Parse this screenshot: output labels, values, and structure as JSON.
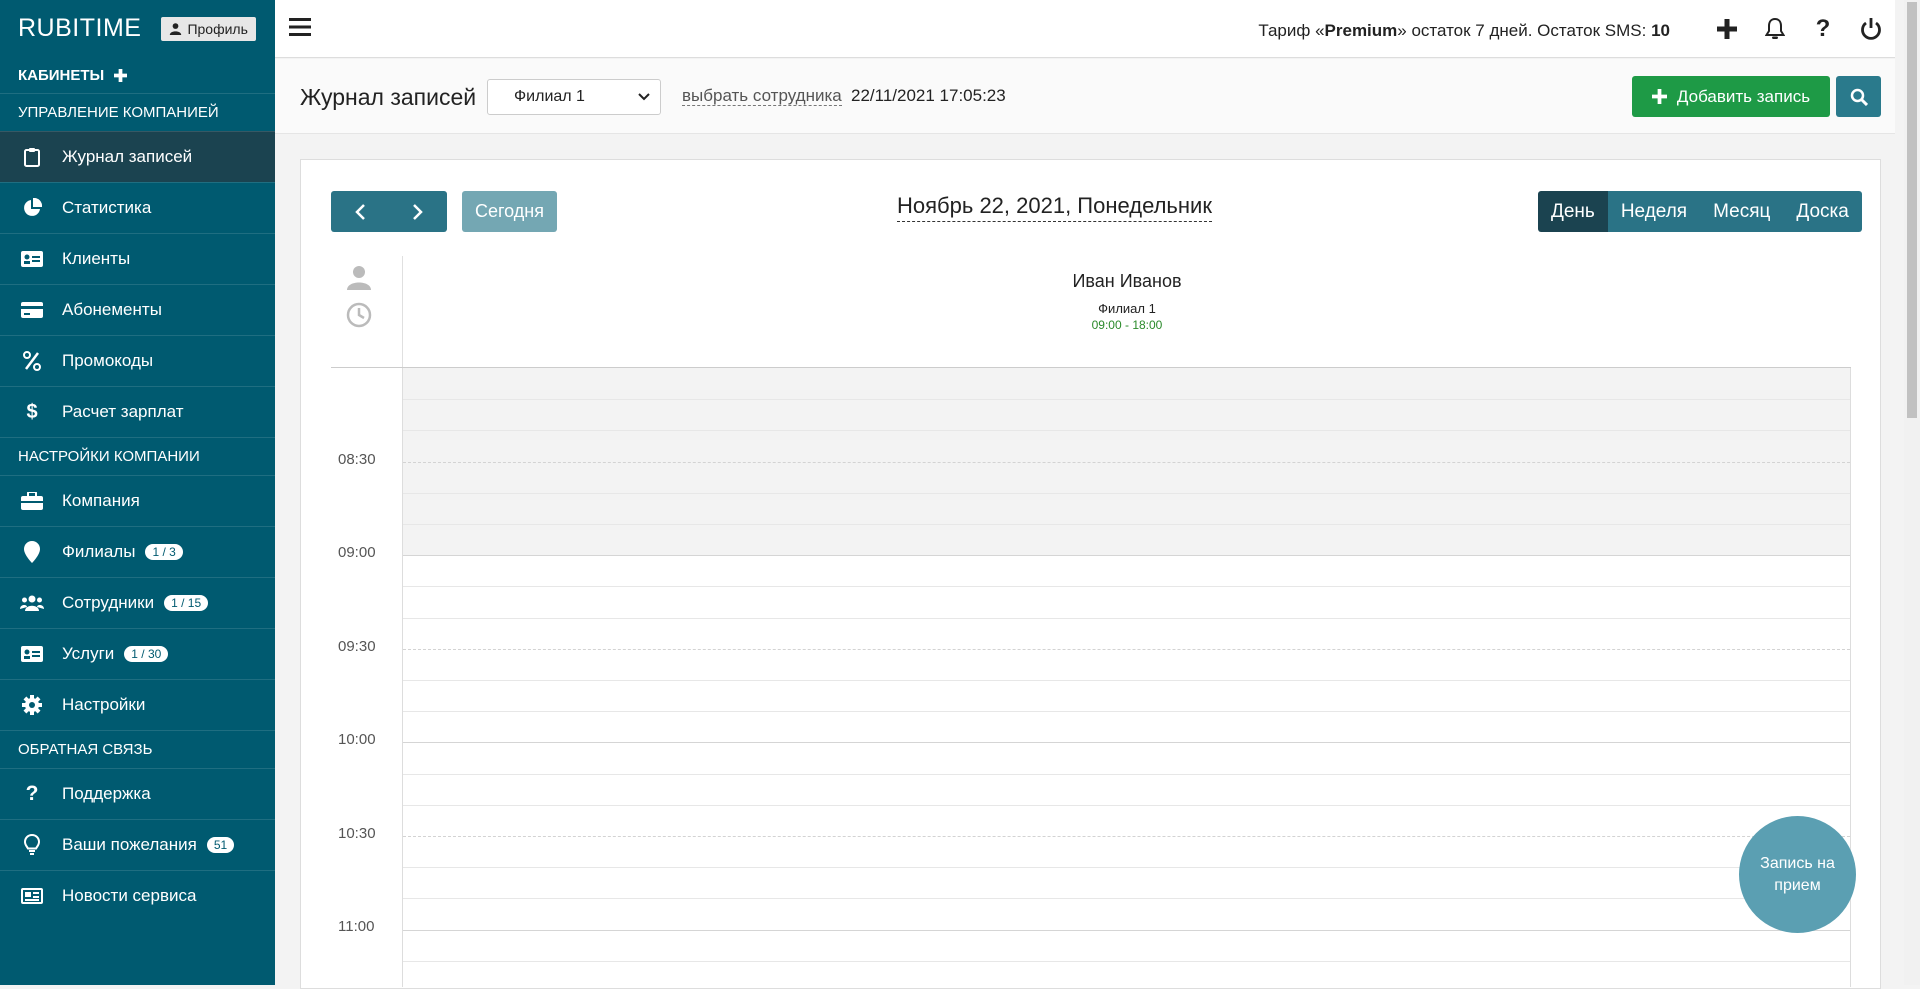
{
  "sidebar": {
    "brand": "RUBITIME",
    "profile_label": "Профиль",
    "cabinets_label": "КАБИНЕТЫ",
    "sections": {
      "management": "УПРАВЛЕНИЕ КОМПАНИЕЙ",
      "settings": "НАСТРОЙКИ КОМПАНИИ",
      "feedback": "ОБРАТНАЯ СВЯЗЬ"
    },
    "items": {
      "journal": "Журнал записей",
      "stats": "Статистика",
      "clients": "Клиенты",
      "subscriptions": "Абонементы",
      "promocodes": "Промокоды",
      "salary": "Расчет зарплат",
      "company": "Компания",
      "branches": "Филиалы",
      "branches_badge": "1 / 3",
      "employees": "Сотрудники",
      "employees_badge": "1 / 15",
      "services": "Услуги",
      "services_badge": "1 / 30",
      "settings": "Настройки",
      "support": "Поддержка",
      "wishes": "Ваши пожелания",
      "wishes_badge": "51",
      "news": "Новости сервиса"
    },
    "colors": {
      "bg": "#005a70",
      "active": "#1b4350"
    }
  },
  "topbar": {
    "tariff_prefix": "Тариф «",
    "tariff_name": "Premium",
    "tariff_suffix": "» остаток 7 дней. Остаток SMS: ",
    "sms_count": "10"
  },
  "header": {
    "title": "Журнал записей",
    "branch_selected": "Филиал 1",
    "pick_employee": "выбрать сотрудника",
    "datetime": "22/11/2021 17:05:23",
    "add_button": "Добавить запись"
  },
  "calendar": {
    "today_button": "Сегодня",
    "date_title": "Ноябрь 22, 2021, Понедельник",
    "views": [
      "День",
      "Неделя",
      "Месяц",
      "Доска"
    ],
    "active_view": "День",
    "employee": {
      "name": "Иван Иванов",
      "branch": "Филиал 1",
      "hours": "09:00 - 18:00"
    },
    "time_labels": [
      "08:30",
      "09:00",
      "09:30",
      "10:00",
      "10:30",
      "11:00"
    ]
  },
  "fab_label": "Запись на прием"
}
